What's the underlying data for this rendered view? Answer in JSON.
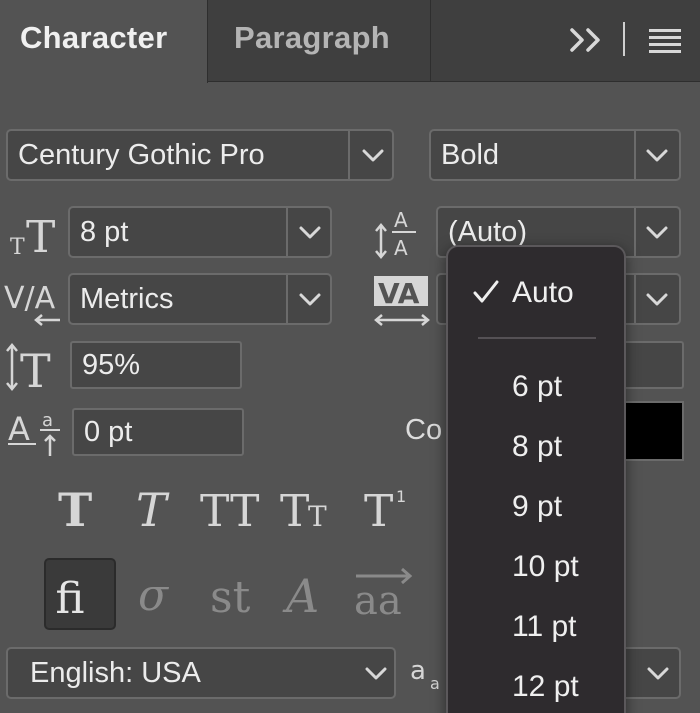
{
  "tabs": {
    "character": "Character",
    "paragraph": "Paragraph"
  },
  "font": {
    "family": "Century Gothic Pro",
    "style": "Bold"
  },
  "size": {
    "value": "8 pt"
  },
  "leading": {
    "value": "(Auto)"
  },
  "kerning": {
    "value": "Metrics"
  },
  "vertical_scale": {
    "value": "95%"
  },
  "baseline_shift": {
    "value": "0 pt"
  },
  "color": {
    "label": "Color:",
    "visible_label": "Co",
    "swatch": "#000000"
  },
  "language": {
    "value": "English: USA"
  },
  "leading_menu": {
    "selected": "Auto",
    "options": [
      "Auto",
      "6 pt",
      "8 pt",
      "9 pt",
      "10 pt",
      "11 pt",
      "12 pt"
    ]
  },
  "theme": {
    "panel_bg": "#535353",
    "tabbar_bg": "#3f3f3f",
    "field_bg": "#464646",
    "menu_bg": "#2e2b2e"
  }
}
